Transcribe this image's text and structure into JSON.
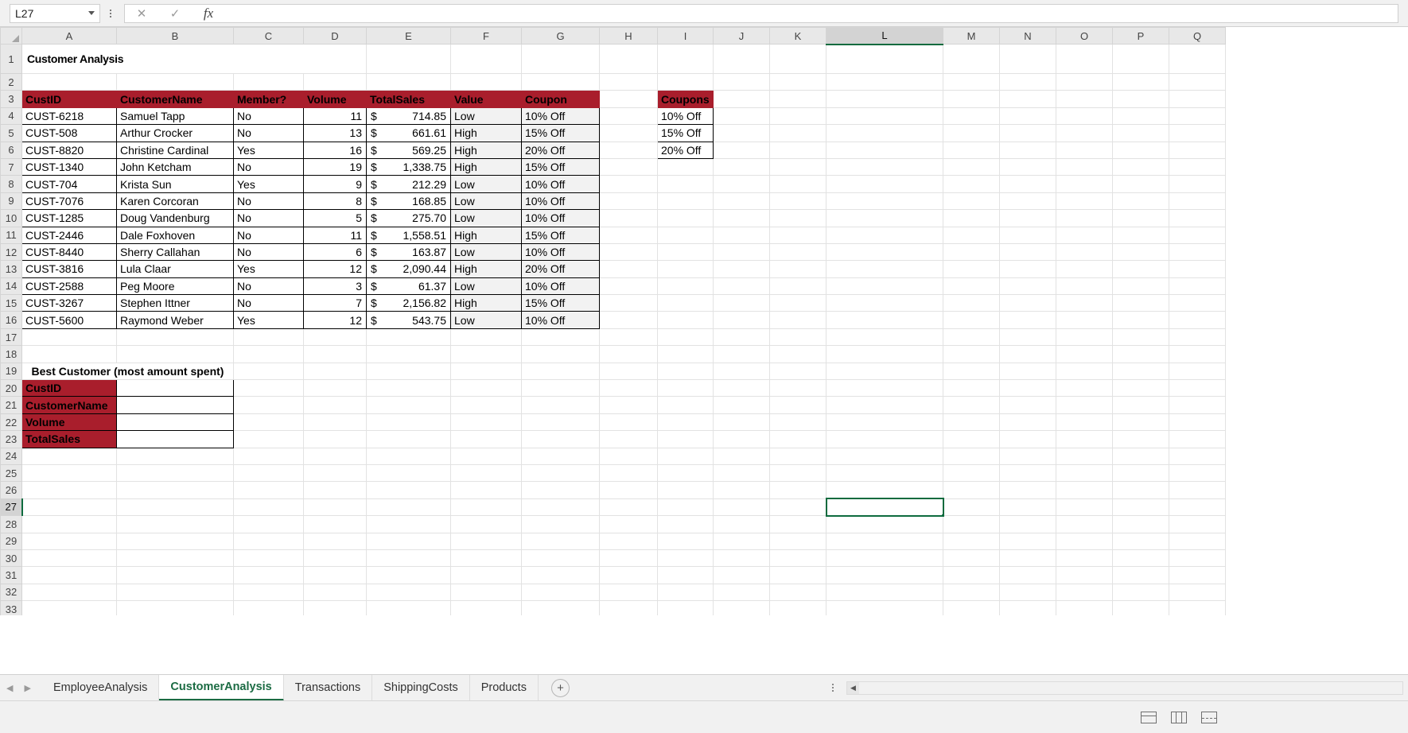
{
  "formula_bar": {
    "name_box_value": "L27",
    "formula_value": "",
    "cancel_icon": "close-icon",
    "confirm_icon": "check-icon",
    "fx_label": "fx"
  },
  "grid": {
    "column_headers": [
      "A",
      "B",
      "C",
      "D",
      "E",
      "F",
      "G",
      "H",
      "I",
      "J",
      "K",
      "L",
      "M",
      "N",
      "O",
      "P",
      "Q"
    ],
    "selected_column": "L",
    "selected_row": "27",
    "row_headers": [
      "1",
      "2",
      "3",
      "4",
      "5",
      "6",
      "7",
      "8",
      "9",
      "10",
      "11",
      "12",
      "13",
      "14",
      "15",
      "16",
      "17",
      "18",
      "19",
      "20",
      "21",
      "22",
      "23",
      "24",
      "25",
      "26",
      "27",
      "28",
      "29",
      "30",
      "31",
      "32",
      "33"
    ]
  },
  "sheet": {
    "title": "Customer Analysis",
    "table_headers": [
      "CustID",
      "CustomerName",
      "Member?",
      "Volume",
      "TotalSales",
      "Value",
      "Coupon"
    ],
    "rows": [
      {
        "custid": "CUST-6218",
        "name": "Samuel Tapp",
        "member": "No",
        "volume": "11",
        "currency": "$",
        "sales": "714.85",
        "value": "Low",
        "coupon": "10% Off"
      },
      {
        "custid": "CUST-508",
        "name": "Arthur Crocker",
        "member": "No",
        "volume": "13",
        "currency": "$",
        "sales": "661.61",
        "value": "High",
        "coupon": "15% Off"
      },
      {
        "custid": "CUST-8820",
        "name": "Christine Cardinal",
        "member": "Yes",
        "volume": "16",
        "currency": "$",
        "sales": "569.25",
        "value": "High",
        "coupon": "20% Off"
      },
      {
        "custid": "CUST-1340",
        "name": "John Ketcham",
        "member": "No",
        "volume": "19",
        "currency": "$",
        "sales": "1,338.75",
        "value": "High",
        "coupon": "15% Off"
      },
      {
        "custid": "CUST-704",
        "name": "Krista Sun",
        "member": "Yes",
        "volume": "9",
        "currency": "$",
        "sales": "212.29",
        "value": "Low",
        "coupon": "10% Off"
      },
      {
        "custid": "CUST-7076",
        "name": "Karen Corcoran",
        "member": "No",
        "volume": "8",
        "currency": "$",
        "sales": "168.85",
        "value": "Low",
        "coupon": "10% Off"
      },
      {
        "custid": "CUST-1285",
        "name": "Doug Vandenburg",
        "member": "No",
        "volume": "5",
        "currency": "$",
        "sales": "275.70",
        "value": "Low",
        "coupon": "10% Off"
      },
      {
        "custid": "CUST-2446",
        "name": "Dale Foxhoven",
        "member": "No",
        "volume": "11",
        "currency": "$",
        "sales": "1,558.51",
        "value": "High",
        "coupon": "15% Off"
      },
      {
        "custid": "CUST-8440",
        "name": "Sherry Callahan",
        "member": "No",
        "volume": "6",
        "currency": "$",
        "sales": "163.87",
        "value": "Low",
        "coupon": "10% Off"
      },
      {
        "custid": "CUST-3816",
        "name": "Lula Claar",
        "member": "Yes",
        "volume": "12",
        "currency": "$",
        "sales": "2,090.44",
        "value": "High",
        "coupon": "20% Off"
      },
      {
        "custid": "CUST-2588",
        "name": "Peg Moore",
        "member": "No",
        "volume": "3",
        "currency": "$",
        "sales": "61.37",
        "value": "Low",
        "coupon": "10% Off"
      },
      {
        "custid": "CUST-3267",
        "name": "Stephen Ittner",
        "member": "No",
        "volume": "7",
        "currency": "$",
        "sales": "2,156.82",
        "value": "High",
        "coupon": "15% Off"
      },
      {
        "custid": "CUST-5600",
        "name": "Raymond Weber",
        "member": "Yes",
        "volume": "12",
        "currency": "$",
        "sales": "543.75",
        "value": "Low",
        "coupon": "10% Off"
      }
    ],
    "coupons_lookup": {
      "header": "Coupons",
      "items": [
        "10% Off",
        "15% Off",
        "20% Off"
      ]
    },
    "best_customer": {
      "title": "Best Customer (most amount spent)",
      "fields": [
        {
          "label": "CustID",
          "value": ""
        },
        {
          "label": "CustomerName",
          "value": ""
        },
        {
          "label": "Volume",
          "value": ""
        },
        {
          "label": "TotalSales",
          "value": ""
        }
      ]
    },
    "colors": {
      "header_red": "#a91e2c",
      "shade_gray": "#f2f2f2",
      "selection_green": "#0e6b3e"
    }
  },
  "tabbar": {
    "prev_arrow": "◀",
    "next_arrow": "▶",
    "tabs": [
      {
        "label": "EmployeeAnalysis",
        "active": false
      },
      {
        "label": "CustomerAnalysis",
        "active": true
      },
      {
        "label": "Transactions",
        "active": false
      },
      {
        "label": "ShippingCosts",
        "active": false
      },
      {
        "label": "Products",
        "active": false
      }
    ],
    "add_sheet_label": "+",
    "scroll_left_arrow": "◀"
  },
  "statusbar": {
    "view_normal": "normal-view-icon",
    "view_layout": "page-layout-icon",
    "view_pagebreak": "page-break-icon"
  }
}
